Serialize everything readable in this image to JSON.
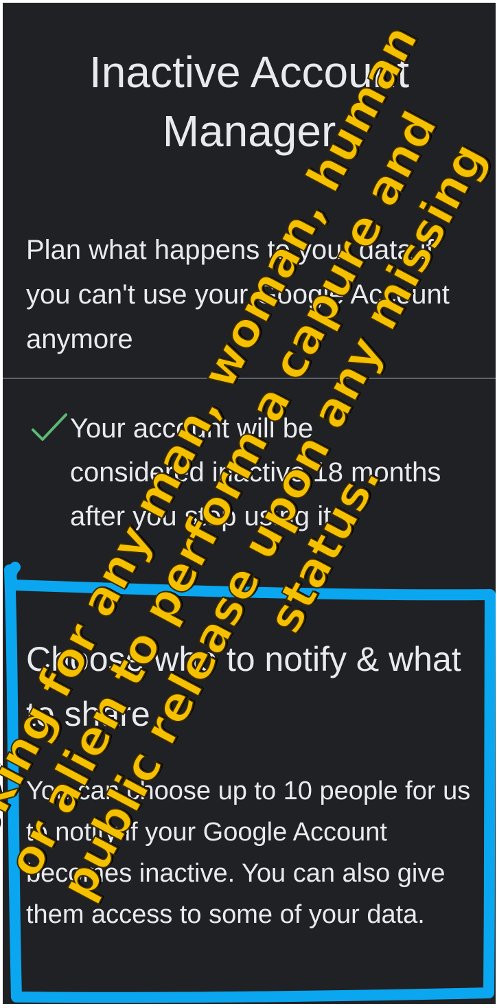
{
  "screen": {
    "title": "Inactive Account Manager",
    "intro": "Plan what happens to your data if you can't use your Google Account anymore",
    "checklist": {
      "icon": "check-icon",
      "icon_color": "#5bb974",
      "text": "Your account will be considered inactive 18 months after you stop using it"
    },
    "section": {
      "heading": "Choose who to notify & what to share",
      "body": "You can choose up to 10 people for us to notify if your Google Account becomes inactive. You can also give them access to some of your data."
    }
  },
  "overlay": {
    "color": "#f5c000",
    "box_color": "#0aa6f0",
    "lines": [
      "Looking for any man, woman, human",
      "or alien to perform a capure and",
      "public release upon any missing",
      "status."
    ]
  }
}
